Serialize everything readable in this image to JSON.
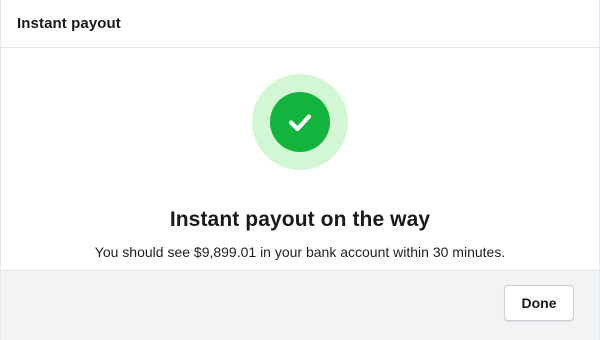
{
  "header": {
    "title": "Instant payout"
  },
  "status": {
    "icon": "check-circle-icon",
    "halo_color": "#d3f7d4",
    "circle_color": "#13b33d",
    "headline": "Instant payout on the way",
    "message": "You should see $9,899.01 in your bank account within 30 minutes."
  },
  "footer": {
    "done_label": "Done"
  }
}
